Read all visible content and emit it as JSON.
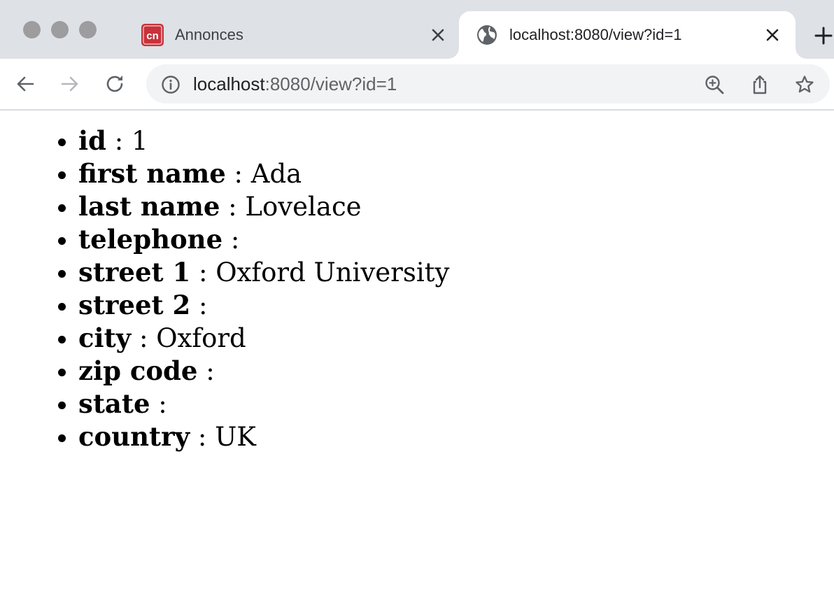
{
  "tabs": [
    {
      "title": "Annonces",
      "favicon": "cn-logo-icon",
      "active": false
    },
    {
      "title": "localhost:8080/view?id=1",
      "favicon": "globe-icon",
      "active": true
    }
  ],
  "omnibox": {
    "host": "localhost",
    "rest": ":8080/view?id=1"
  },
  "record": [
    {
      "key": "id",
      "sep": " : ",
      "value": "1"
    },
    {
      "key": "first name",
      "sep": " : ",
      "value": "Ada"
    },
    {
      "key": "last name",
      "sep": " : ",
      "value": "Lovelace"
    },
    {
      "key": "telephone",
      "sep": " : ",
      "value": ""
    },
    {
      "key": "street 1",
      "sep": " : ",
      "value": "Oxford University"
    },
    {
      "key": "street 2",
      "sep": " : ",
      "value": ""
    },
    {
      "key": "city",
      "sep": " : ",
      "value": "Oxford"
    },
    {
      "key": "zip code",
      "sep": " : ",
      "value": ""
    },
    {
      "key": "state",
      "sep": " : ",
      "value": ""
    },
    {
      "key": "country",
      "sep": " : ",
      "value": "UK"
    }
  ],
  "colors": {
    "tabstrip": "#dee1e6",
    "omnibox": "#f1f3f4",
    "favicon_red": "#c8323a"
  }
}
